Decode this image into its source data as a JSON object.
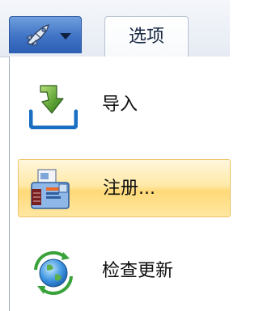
{
  "tabs": {
    "app_button_icon": "rocket-icon",
    "options_label": "选项"
  },
  "menu": {
    "items": [
      {
        "label": "导入",
        "icon": "import-icon"
      },
      {
        "label": "注册...",
        "icon": "register-card-icon"
      },
      {
        "label": "检查更新",
        "icon": "globe-refresh-icon"
      }
    ]
  },
  "colors": {
    "highlight": "#ffd978",
    "app_button": "#3f73c4"
  }
}
